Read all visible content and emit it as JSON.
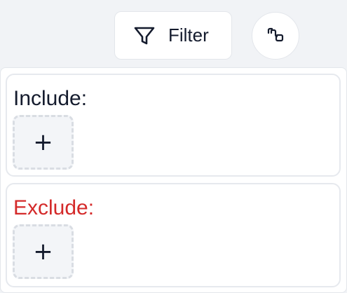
{
  "toolbar": {
    "filter_label": "Filter",
    "filter_icon": "funnel-icon",
    "link_icon": "link-nodes-icon"
  },
  "include": {
    "title": "Include:",
    "title_color": "#141b2d",
    "add_symbol": "+"
  },
  "exclude": {
    "title": "Exclude:",
    "title_color": "#d42a2a",
    "add_symbol": "+"
  }
}
